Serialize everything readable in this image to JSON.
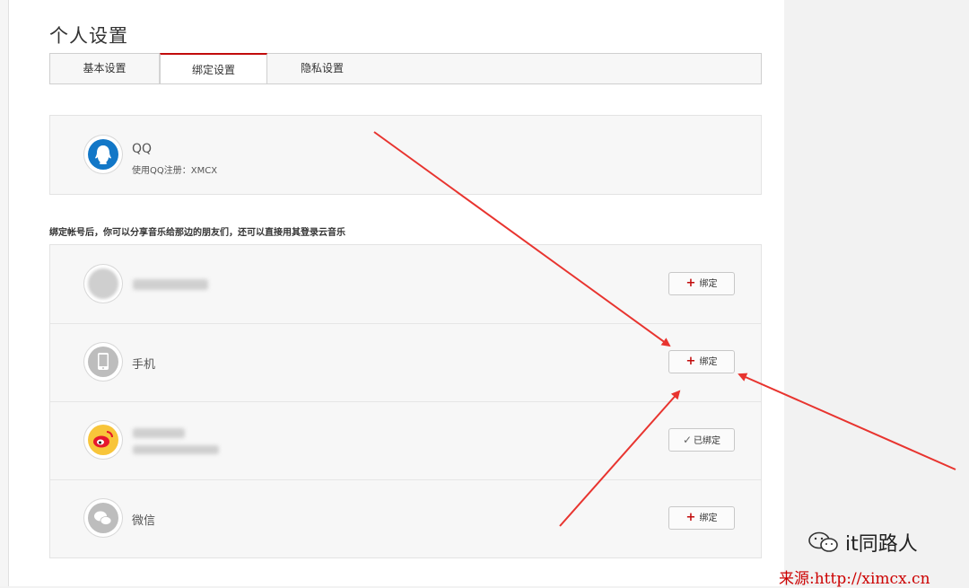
{
  "page": {
    "title": "个人设置"
  },
  "tabs": [
    {
      "label": "基本设置",
      "active": false
    },
    {
      "label": "绑定设置",
      "active": true
    },
    {
      "label": "隐私设置",
      "active": false
    }
  ],
  "qq": {
    "name": "QQ",
    "sub": "使用QQ注册：XMCX",
    "icon": "qq-icon"
  },
  "hint": "绑定帐号后，你可以分享音乐给那边的朋友们，还可以直接用其登录云音乐",
  "rows": [
    {
      "label": "",
      "icon": "blurred-icon",
      "button": {
        "symbol": "+",
        "label": "绑定"
      }
    },
    {
      "label": "手机",
      "icon": "phone-icon",
      "button": {
        "symbol": "+",
        "label": "绑定"
      }
    },
    {
      "label": "",
      "icon": "weibo-icon",
      "button": {
        "symbol": "✓",
        "label": "已绑定"
      }
    },
    {
      "label": "微信",
      "icon": "wechat-icon",
      "button": {
        "symbol": "+",
        "label": "绑定"
      }
    }
  ],
  "watermark": {
    "text": "it同路人"
  },
  "source": "来源:http://ximcx.cn",
  "colors": {
    "accent": "#c20c0c",
    "arrow": "#e8342f",
    "qq_blue": "#1277c7",
    "weibo_yellow": "#f8c53a"
  }
}
